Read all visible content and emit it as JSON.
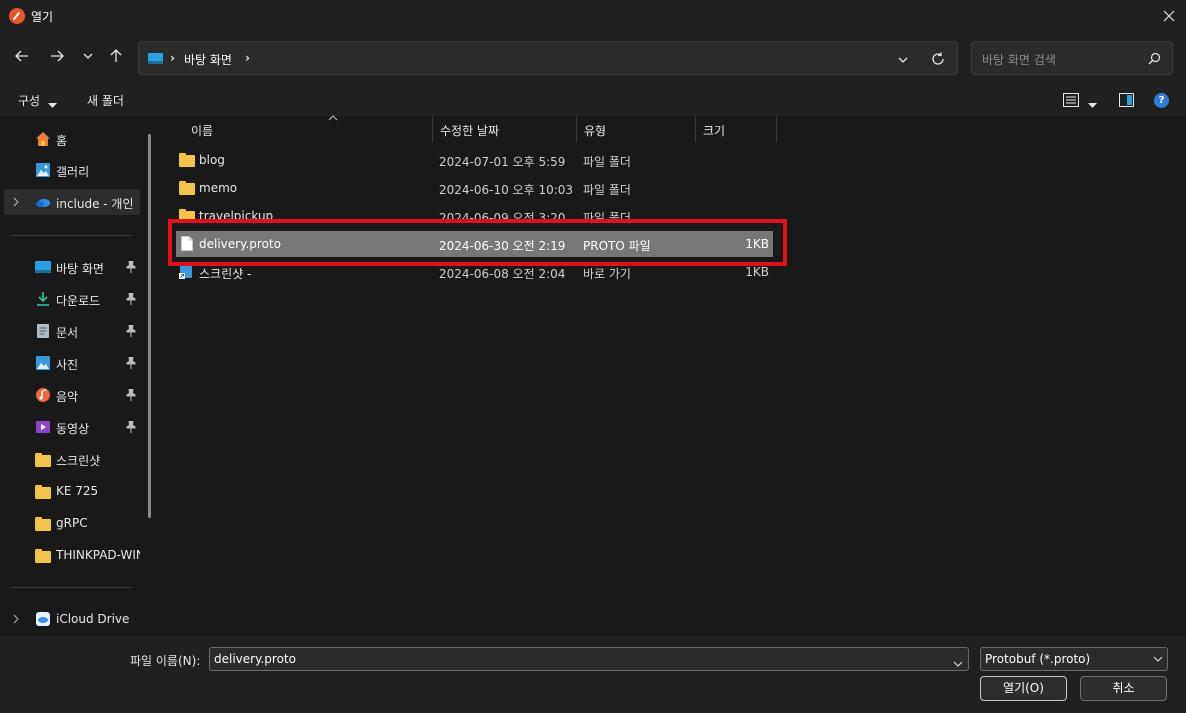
{
  "window": {
    "title": "열기"
  },
  "address": {
    "location": "바탕 화면",
    "separator": "›"
  },
  "search": {
    "placeholder": "바탕 화면 검색"
  },
  "toolbar": {
    "organize_label": "구성",
    "new_folder_label": "새 폴더",
    "help_label": "?"
  },
  "sidebar": {
    "items": [
      {
        "label": "홈",
        "icon": "home-icon"
      },
      {
        "label": "갤러리",
        "icon": "gallery-icon"
      },
      {
        "label": "include - 개인",
        "icon": "onedrive-icon"
      },
      {
        "label": "바탕 화면",
        "icon": "desktop-icon",
        "pinned": true
      },
      {
        "label": "다운로드",
        "icon": "download-icon",
        "pinned": true
      },
      {
        "label": "문서",
        "icon": "document-icon",
        "pinned": true
      },
      {
        "label": "사진",
        "icon": "photo-icon",
        "pinned": true
      },
      {
        "label": "음악",
        "icon": "music-icon",
        "pinned": true
      },
      {
        "label": "동영상",
        "icon": "video-icon",
        "pinned": true
      },
      {
        "label": "스크린샷",
        "icon": "folder-icon"
      },
      {
        "label": "KE 725",
        "icon": "folder-icon"
      },
      {
        "label": "gRPC",
        "icon": "folder-icon"
      },
      {
        "label": "THINKPAD-WIN",
        "icon": "folder-icon"
      },
      {
        "label": "iCloud Drive",
        "icon": "icloud-icon"
      }
    ]
  },
  "columns": {
    "name": "이름",
    "modified": "수정한 날짜",
    "type": "유형",
    "size": "크기"
  },
  "files": [
    {
      "name": "blog",
      "modified": "2024-07-01 오후 5:59",
      "type": "파일 폴더",
      "size": "",
      "icon": "folder-icon"
    },
    {
      "name": "memo",
      "modified": "2024-06-10 오후 10:03",
      "type": "파일 폴더",
      "size": "",
      "icon": "folder-icon"
    },
    {
      "name": "travelpickup",
      "modified": "2024-06-09 오전 3:20",
      "type": "파일 폴더",
      "size": "",
      "icon": "folder-icon"
    },
    {
      "name": "delivery.proto",
      "modified": "2024-06-30 오전 2:19",
      "type": "PROTO 파일",
      "size": "1KB",
      "icon": "file-icon",
      "selected": true
    },
    {
      "name": "스크린샷 -",
      "modified": "2024-06-08 오전 2:04",
      "type": "바로 가기",
      "size": "1KB",
      "icon": "shortcut-icon"
    }
  ],
  "footer": {
    "filename_label": "파일 이름(N):",
    "filename_value": "delivery.proto",
    "filter_value": "Protobuf (*.proto)",
    "open_label": "열기(O)",
    "cancel_label": "취소"
  },
  "colors": {
    "highlight": "#e01020",
    "selection": "#777777",
    "folder": "#f4c34c",
    "accent": "#2a7fd4"
  }
}
